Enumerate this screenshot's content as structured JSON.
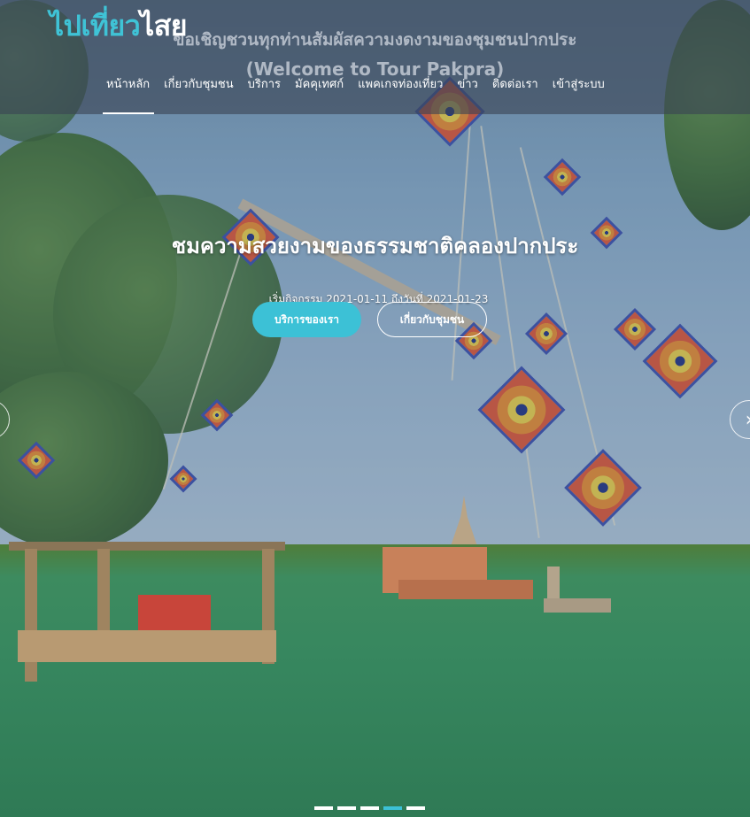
{
  "brand": {
    "logo_part1": "ไปเที่ยว",
    "logo_part2": "ไสย"
  },
  "header": {
    "tagline_th": "ขอเชิญชวนทุกท่านสัมผัสความงดงามของชุมชนปากประ",
    "tagline_en": "(Welcome to Tour Pakpra)"
  },
  "nav": {
    "items": [
      {
        "label": "หน้าหลัก",
        "active": true
      },
      {
        "label": "เกี่ยวกับชุมชน"
      },
      {
        "label": "บริการ"
      },
      {
        "label": "มัคคุเทศก์"
      },
      {
        "label": "แพคเกจท่องเที่ยว"
      },
      {
        "label": "ข่าว"
      },
      {
        "label": "ติดต่อเรา"
      },
      {
        "label": "เข้าสู่ระบบ"
      }
    ]
  },
  "hero": {
    "title": "ชมความสวยงามของธรรมชาติคลองปากประ",
    "date_text": "เริ่มกิจกรรม 2021-01-11 ถึงวันที่ 2021-01-23",
    "primary_button": "บริการของเรา",
    "secondary_button": "เกี่ยวกับชุมชน"
  },
  "carousel": {
    "prev_icon": "chevron-left-icon",
    "next_icon": "chevron-right-icon",
    "prev_glyph": "‹",
    "next_glyph": "›",
    "slide_count": 5,
    "active_index": 3
  },
  "colors": {
    "accent": "#3cc1d6",
    "header_bg": "rgba(58,68,84,0.62)"
  }
}
